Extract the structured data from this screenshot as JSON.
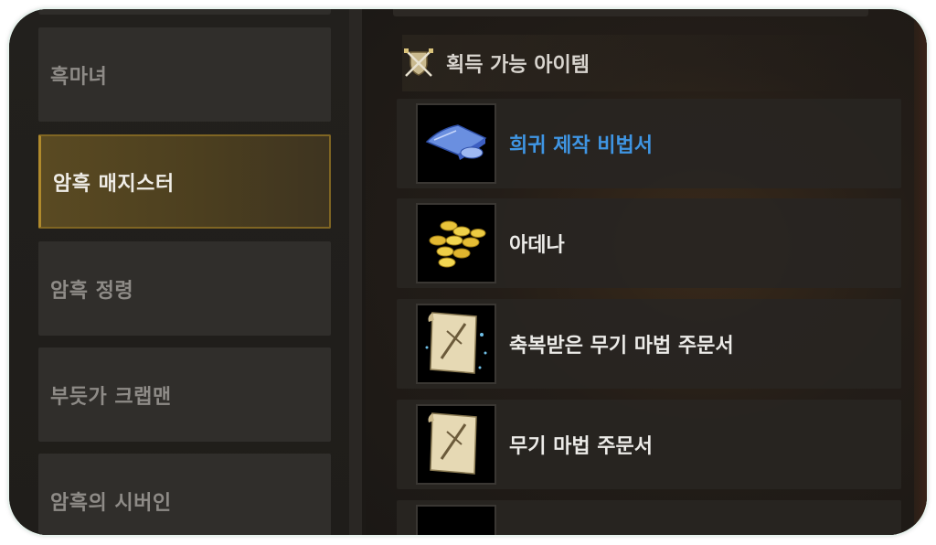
{
  "sidebar": {
    "categories": [
      {
        "label": "흑마녀"
      },
      {
        "label": "암흑 매지스터"
      },
      {
        "label": "암흑 정령"
      },
      {
        "label": "부듯가 크랩맨"
      },
      {
        "label": "암흑의 시버인"
      }
    ],
    "active_index": 1
  },
  "main": {
    "section_title": "획득 가능 아이템",
    "section_icon": "sword-shield-icon",
    "items": [
      {
        "name": "희귀 제작 비법서",
        "icon": "blueprint-scroll-icon",
        "rarity_color": "#3f95e3"
      },
      {
        "name": "아데나",
        "icon": "gold-coins-icon"
      },
      {
        "name": "축복받은 무기 마법 주문서",
        "icon": "weapon-scroll-blessed-icon"
      },
      {
        "name": "무기 마법 주문서",
        "icon": "weapon-scroll-icon"
      }
    ]
  },
  "colors": {
    "accent_gold": "#b08a2c",
    "rare_blue": "#3f95e3"
  }
}
